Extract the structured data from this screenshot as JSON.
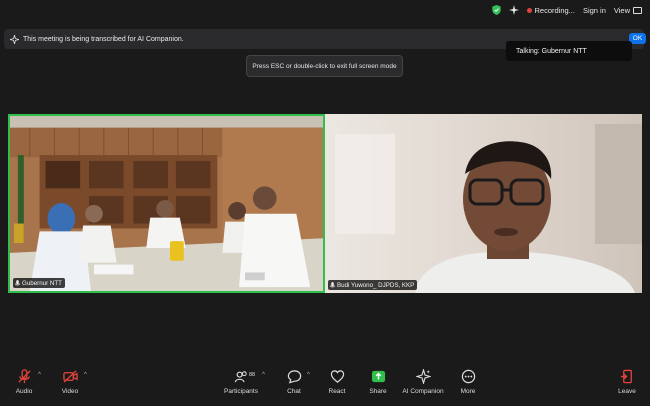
{
  "top_bar": {
    "recording_label": "Recording...",
    "signin_label": "Sign in",
    "view_label": "View",
    "colors": {
      "shield": "#35c15a",
      "recording_dot": "#e0453a"
    }
  },
  "transcript_banner": {
    "text": "This meeting is being transcribed for AI Companion.",
    "ok_label": "OK"
  },
  "talking_indicator": "Talking: Gubernur NTT",
  "fullscreen_tip": "Press ESC or double-click to exit full screen mode",
  "video_tiles": [
    {
      "name": "Gubernur NTT",
      "active_speaker": true
    },
    {
      "name": "Budi Yuwono_ DJPDS, KKP",
      "active_speaker": false
    }
  ],
  "toolbar": {
    "audio_label": "Audio",
    "video_label": "Video",
    "participants_label": "Participants",
    "participants_count": "88",
    "chat_label": "Chat",
    "react_label": "React",
    "share_label": "Share",
    "ai_companion_label": "AI Companion",
    "more_label": "More",
    "leave_label": "Leave",
    "colors": {
      "muted": "#e0453a",
      "share": "#2fbf4a",
      "leave": "#e0453a"
    }
  }
}
